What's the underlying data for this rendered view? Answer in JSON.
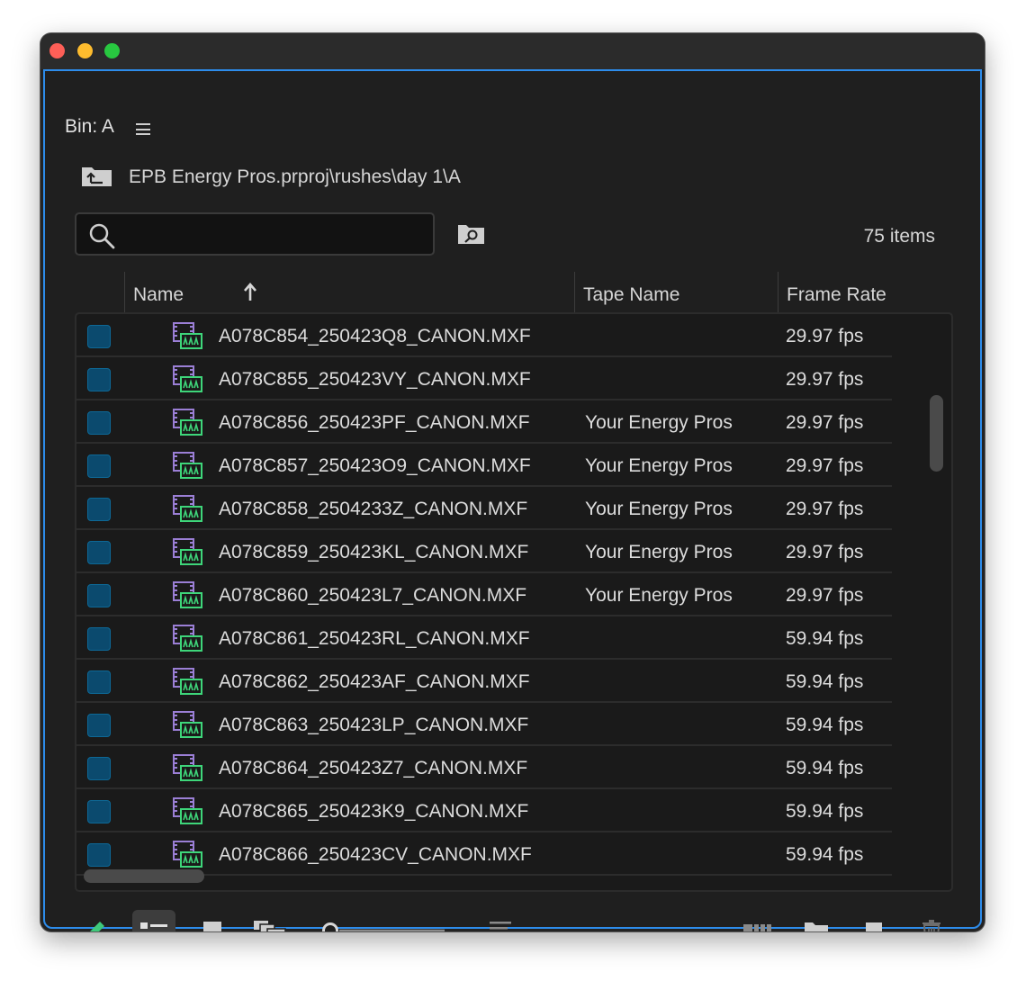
{
  "panel": {
    "title": "Bin: A",
    "path": "EPB Energy Pros.prproj\\rushes\\day 1\\A",
    "item_count": "75 items"
  },
  "search": {
    "value": "",
    "placeholder": ""
  },
  "columns": {
    "name": "Name",
    "tape": "Tape Name",
    "fps": "Frame Rate"
  },
  "rows": [
    {
      "name": "A078C854_250423Q8_CANON.MXF",
      "tape": "",
      "fps": "29.97 fps"
    },
    {
      "name": "A078C855_250423VY_CANON.MXF",
      "tape": "",
      "fps": "29.97 fps"
    },
    {
      "name": "A078C856_250423PF_CANON.MXF",
      "tape": "Your Energy Pros",
      "fps": "29.97 fps"
    },
    {
      "name": "A078C857_250423O9_CANON.MXF",
      "tape": "Your Energy Pros",
      "fps": "29.97 fps"
    },
    {
      "name": "A078C858_2504233Z_CANON.MXF",
      "tape": "Your Energy Pros",
      "fps": "29.97 fps"
    },
    {
      "name": "A078C859_250423KL_CANON.MXF",
      "tape": "Your Energy Pros",
      "fps": "29.97 fps"
    },
    {
      "name": "A078C860_250423L7_CANON.MXF",
      "tape": "Your Energy Pros",
      "fps": "29.97 fps"
    },
    {
      "name": "A078C861_250423RL_CANON.MXF",
      "tape": "",
      "fps": "59.94 fps"
    },
    {
      "name": "A078C862_250423AF_CANON.MXF",
      "tape": "",
      "fps": "59.94 fps"
    },
    {
      "name": "A078C863_250423LP_CANON.MXF",
      "tape": "",
      "fps": "59.94 fps"
    },
    {
      "name": "A078C864_250423Z7_CANON.MXF",
      "tape": "",
      "fps": "59.94 fps"
    },
    {
      "name": "A078C865_250423K9_CANON.MXF",
      "tape": "",
      "fps": "59.94 fps"
    },
    {
      "name": "A078C866_250423CV_CANON.MXF",
      "tape": "",
      "fps": "59.94 fps"
    }
  ],
  "toolbar": {
    "icons": [
      "pencil-icon",
      "list-view-icon",
      "icon-view-icon",
      "freeform-view-icon",
      "zoom-slider",
      "sort-icons-icon",
      "automate-to-sequence-icon",
      "new-bin-icon",
      "new-item-icon",
      "clear-trash-icon"
    ],
    "active_view": "list-view"
  },
  "colors": {
    "panel_bg": "#1f1f1f",
    "focus_border": "#2d8ceb",
    "checkbox_fill": "#0b4a6e",
    "clip_icon_purple": "#9b7fd6",
    "clip_icon_green": "#3ed67a",
    "pencil_green": "#3ec97a"
  }
}
